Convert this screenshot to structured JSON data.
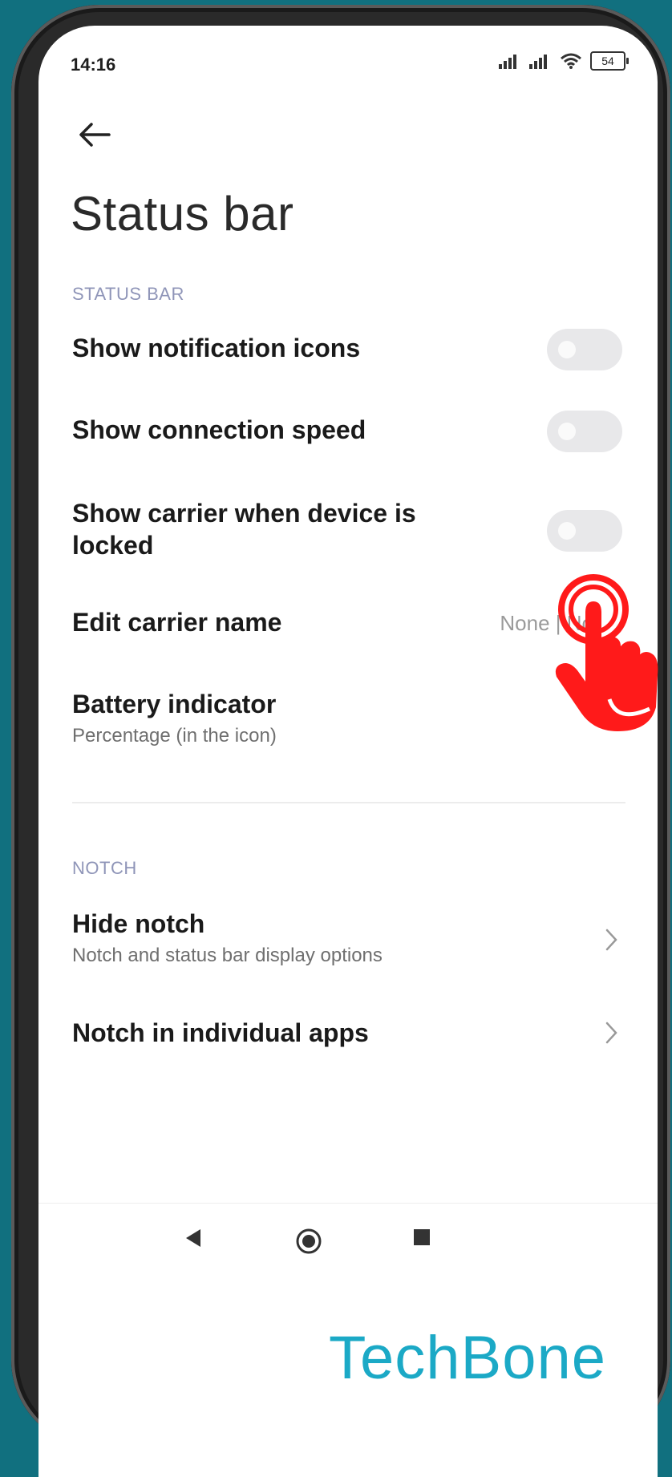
{
  "status_bar": {
    "time": "14:16",
    "battery_level": "54",
    "icons": [
      "signal-icon",
      "signal-icon",
      "wifi-icon",
      "battery-icon"
    ]
  },
  "header": {
    "back_icon": "arrow-left-icon",
    "title": "Status bar"
  },
  "sections": {
    "status_bar": {
      "header": "STATUS BAR",
      "items": [
        {
          "title": "Show notification icons",
          "control": "toggle",
          "on": false
        },
        {
          "title": "Show connection speed",
          "control": "toggle",
          "on": false
        },
        {
          "title": "Show carrier when device is locked",
          "control": "toggle",
          "on": false
        },
        {
          "title": "Edit carrier name",
          "value": "None | No"
        },
        {
          "title": "Battery indicator",
          "subtitle": "Percentage (in the icon)",
          "control": "selector"
        }
      ]
    },
    "notch": {
      "header": "NOTCH",
      "items": [
        {
          "title": "Hide notch",
          "subtitle": "Notch and status bar display options",
          "control": "chevron"
        },
        {
          "title": "Notch in individual apps",
          "control": "chevron"
        }
      ]
    }
  },
  "navigation": [
    "back-triangle-icon",
    "home-circle-icon",
    "recents-square-icon"
  ],
  "overlay": {
    "tap_hand_icon": "tap-hand-icon",
    "watermark": "TechBone",
    "accent_color": "#ff1a1a",
    "watermark_color": "#1ba9c6"
  }
}
